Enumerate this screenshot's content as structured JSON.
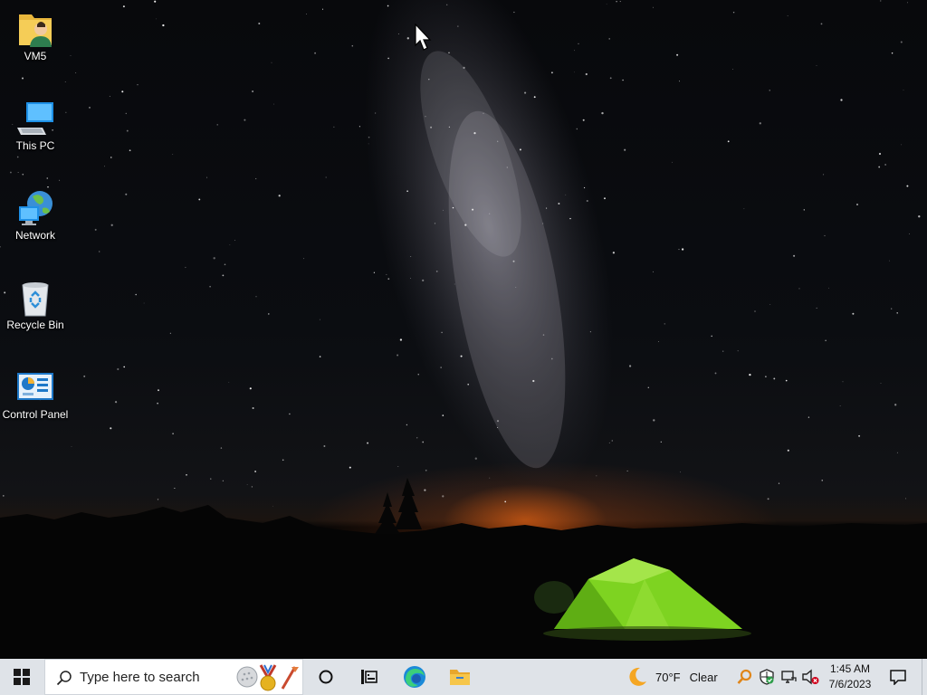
{
  "desktop_icons": [
    {
      "label": "VM5",
      "icon": "user-folder-icon"
    },
    {
      "label": "This PC",
      "icon": "computer-icon"
    },
    {
      "label": "Network",
      "icon": "network-icon"
    },
    {
      "label": "Recycle Bin",
      "icon": "recycle-bin-icon"
    },
    {
      "label": "Control Panel",
      "icon": "control-panel-icon"
    }
  ],
  "taskbar": {
    "start_icon": "windows-logo-icon",
    "search_placeholder": "Type here to search",
    "search_highlight_icon": "search-highlight-icon",
    "pinned": [
      {
        "icon": "cortana-icon"
      },
      {
        "icon": "task-view-icon"
      },
      {
        "icon": "edge-icon"
      },
      {
        "icon": "file-explorer-icon"
      }
    ],
    "weather": {
      "temp": "70°F",
      "condition": "Clear",
      "icon": "moon-icon"
    },
    "tray_icons": [
      "magnifier-icon",
      "security-shield-icon",
      "network-disconnected-icon",
      "volume-muted-icon"
    ],
    "clock": {
      "time": "1:45 AM",
      "date": "7/6/2023"
    },
    "notification_icon": "notification-center-icon"
  },
  "colors": {
    "taskbar_bg": "#dfe3e8",
    "tent_green": "#7ed321",
    "horizon_glow": "#ff6a14"
  }
}
